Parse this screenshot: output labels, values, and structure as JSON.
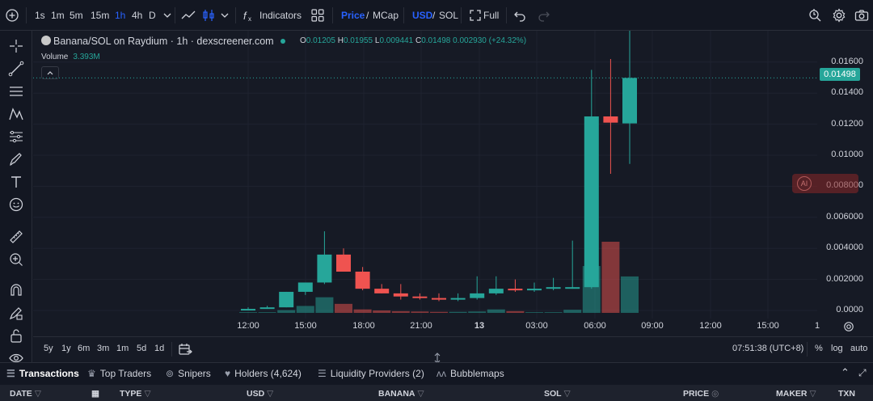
{
  "toolbar": {
    "timeframes": [
      "1s",
      "1m",
      "5m",
      "15m",
      "1h",
      "4h",
      "D"
    ],
    "active_timeframe": "1h",
    "indicators_label": "Indicators",
    "price_label": "Price",
    "mcap_label": "MCap",
    "usd_label": "USD",
    "sol_label": "SOL",
    "full_label": "Full",
    "slash": "/"
  },
  "legend": {
    "title": "Banana/SOL on Raydium · 1h · dexscreener.com",
    "o_key": "O",
    "o_val": "0.01205",
    "h_key": "H",
    "h_val": "0.01955",
    "l_key": "L",
    "l_val": "0.009441",
    "c_key": "C",
    "c_val": "0.01498",
    "change": "0.002930 (+24.32%)",
    "volume_label": "Volume",
    "volume_value": "3.393M"
  },
  "price_axis": {
    "labels": [
      "0.01600",
      "0.01400",
      "0.01200",
      "0.01000",
      "0.008000",
      "0.006000",
      "0.004000",
      "0.002000",
      "0.0000"
    ],
    "last_price": "0.01498"
  },
  "time_axis": {
    "labels": [
      "12:00",
      "15:00",
      "18:00",
      "21:00",
      "13",
      "03:00",
      "06:00",
      "09:00",
      "12:00",
      "15:00",
      "1"
    ]
  },
  "bottom": {
    "ranges": [
      "5y",
      "1y",
      "6m",
      "3m",
      "1m",
      "5d",
      "1d"
    ],
    "clock": "07:51:38 (UTC+8)",
    "percent": "%",
    "log": "log",
    "auto": "auto"
  },
  "tabs": [
    {
      "label": "Transactions",
      "icon": "list-icon"
    },
    {
      "label": "Top Traders",
      "icon": "trophy-icon"
    },
    {
      "label": "Snipers",
      "icon": "crosshair-icon"
    },
    {
      "label": "Holders (4,624)",
      "icon": "heart-icon"
    },
    {
      "label": "Liquidity Providers (2)",
      "icon": "list-icon"
    },
    {
      "label": "Bubblemaps",
      "icon": "bubblemaps-icon"
    }
  ],
  "table_headers": [
    "DATE",
    "TYPE",
    "USD",
    "BANANA",
    "SOL",
    "PRICE",
    "MAKER",
    "TXN"
  ],
  "colors": {
    "up": "#26a69a",
    "down": "#ef5350",
    "accent": "#2962ff"
  },
  "chart_data": {
    "type": "candlestick",
    "x": [
      "11:00",
      "12:00",
      "13:00",
      "14:00",
      "15:00",
      "16:00",
      "17:00",
      "18:00",
      "19:00",
      "20:00",
      "21:00",
      "22:00",
      "23:00",
      "00:00",
      "01:00",
      "02:00",
      "03:00",
      "04:00",
      "05:00",
      "06:00",
      "07:00"
    ],
    "open": [
      0.0,
      0.0001,
      0.0002,
      0.0012,
      0.0018,
      0.0036,
      0.0025,
      0.0014,
      0.0011,
      0.0009,
      0.0008,
      0.0007,
      0.0008,
      0.0011,
      0.0014,
      0.0013,
      0.0014,
      0.0015,
      0.0015,
      0.0125,
      0.01205
    ],
    "high": [
      0.0002,
      0.0003,
      0.0012,
      0.0015,
      0.0051,
      0.004,
      0.0028,
      0.0017,
      0.0017,
      0.0011,
      0.0011,
      0.0011,
      0.0022,
      0.0022,
      0.002,
      0.0018,
      0.0021,
      0.0045,
      0.0155,
      0.0162,
      0.01955
    ],
    "low": [
      0.0,
      0.0001,
      0.0002,
      0.001,
      0.0017,
      0.0025,
      0.0013,
      0.0011,
      0.0007,
      0.0007,
      0.0006,
      0.0006,
      0.0007,
      0.001,
      0.0012,
      0.0012,
      0.0013,
      0.0014,
      0.0014,
      0.0088,
      0.009441
    ],
    "close": [
      0.0001,
      0.0002,
      0.0012,
      0.0018,
      0.0036,
      0.0025,
      0.0014,
      0.0011,
      0.0009,
      0.0008,
      0.0007,
      0.0008,
      0.0011,
      0.0014,
      0.0013,
      0.0014,
      0.0015,
      0.0015,
      0.0125,
      0.0121,
      0.01498
    ],
    "volume": [
      0.02,
      0.02,
      0.08,
      0.2,
      0.45,
      0.26,
      0.1,
      0.07,
      0.05,
      0.04,
      0.03,
      0.03,
      0.04,
      0.1,
      0.05,
      0.02,
      0.02,
      0.09,
      1.35,
      2.05,
      1.05
    ],
    "ylim": [
      0,
      0.0175
    ]
  }
}
